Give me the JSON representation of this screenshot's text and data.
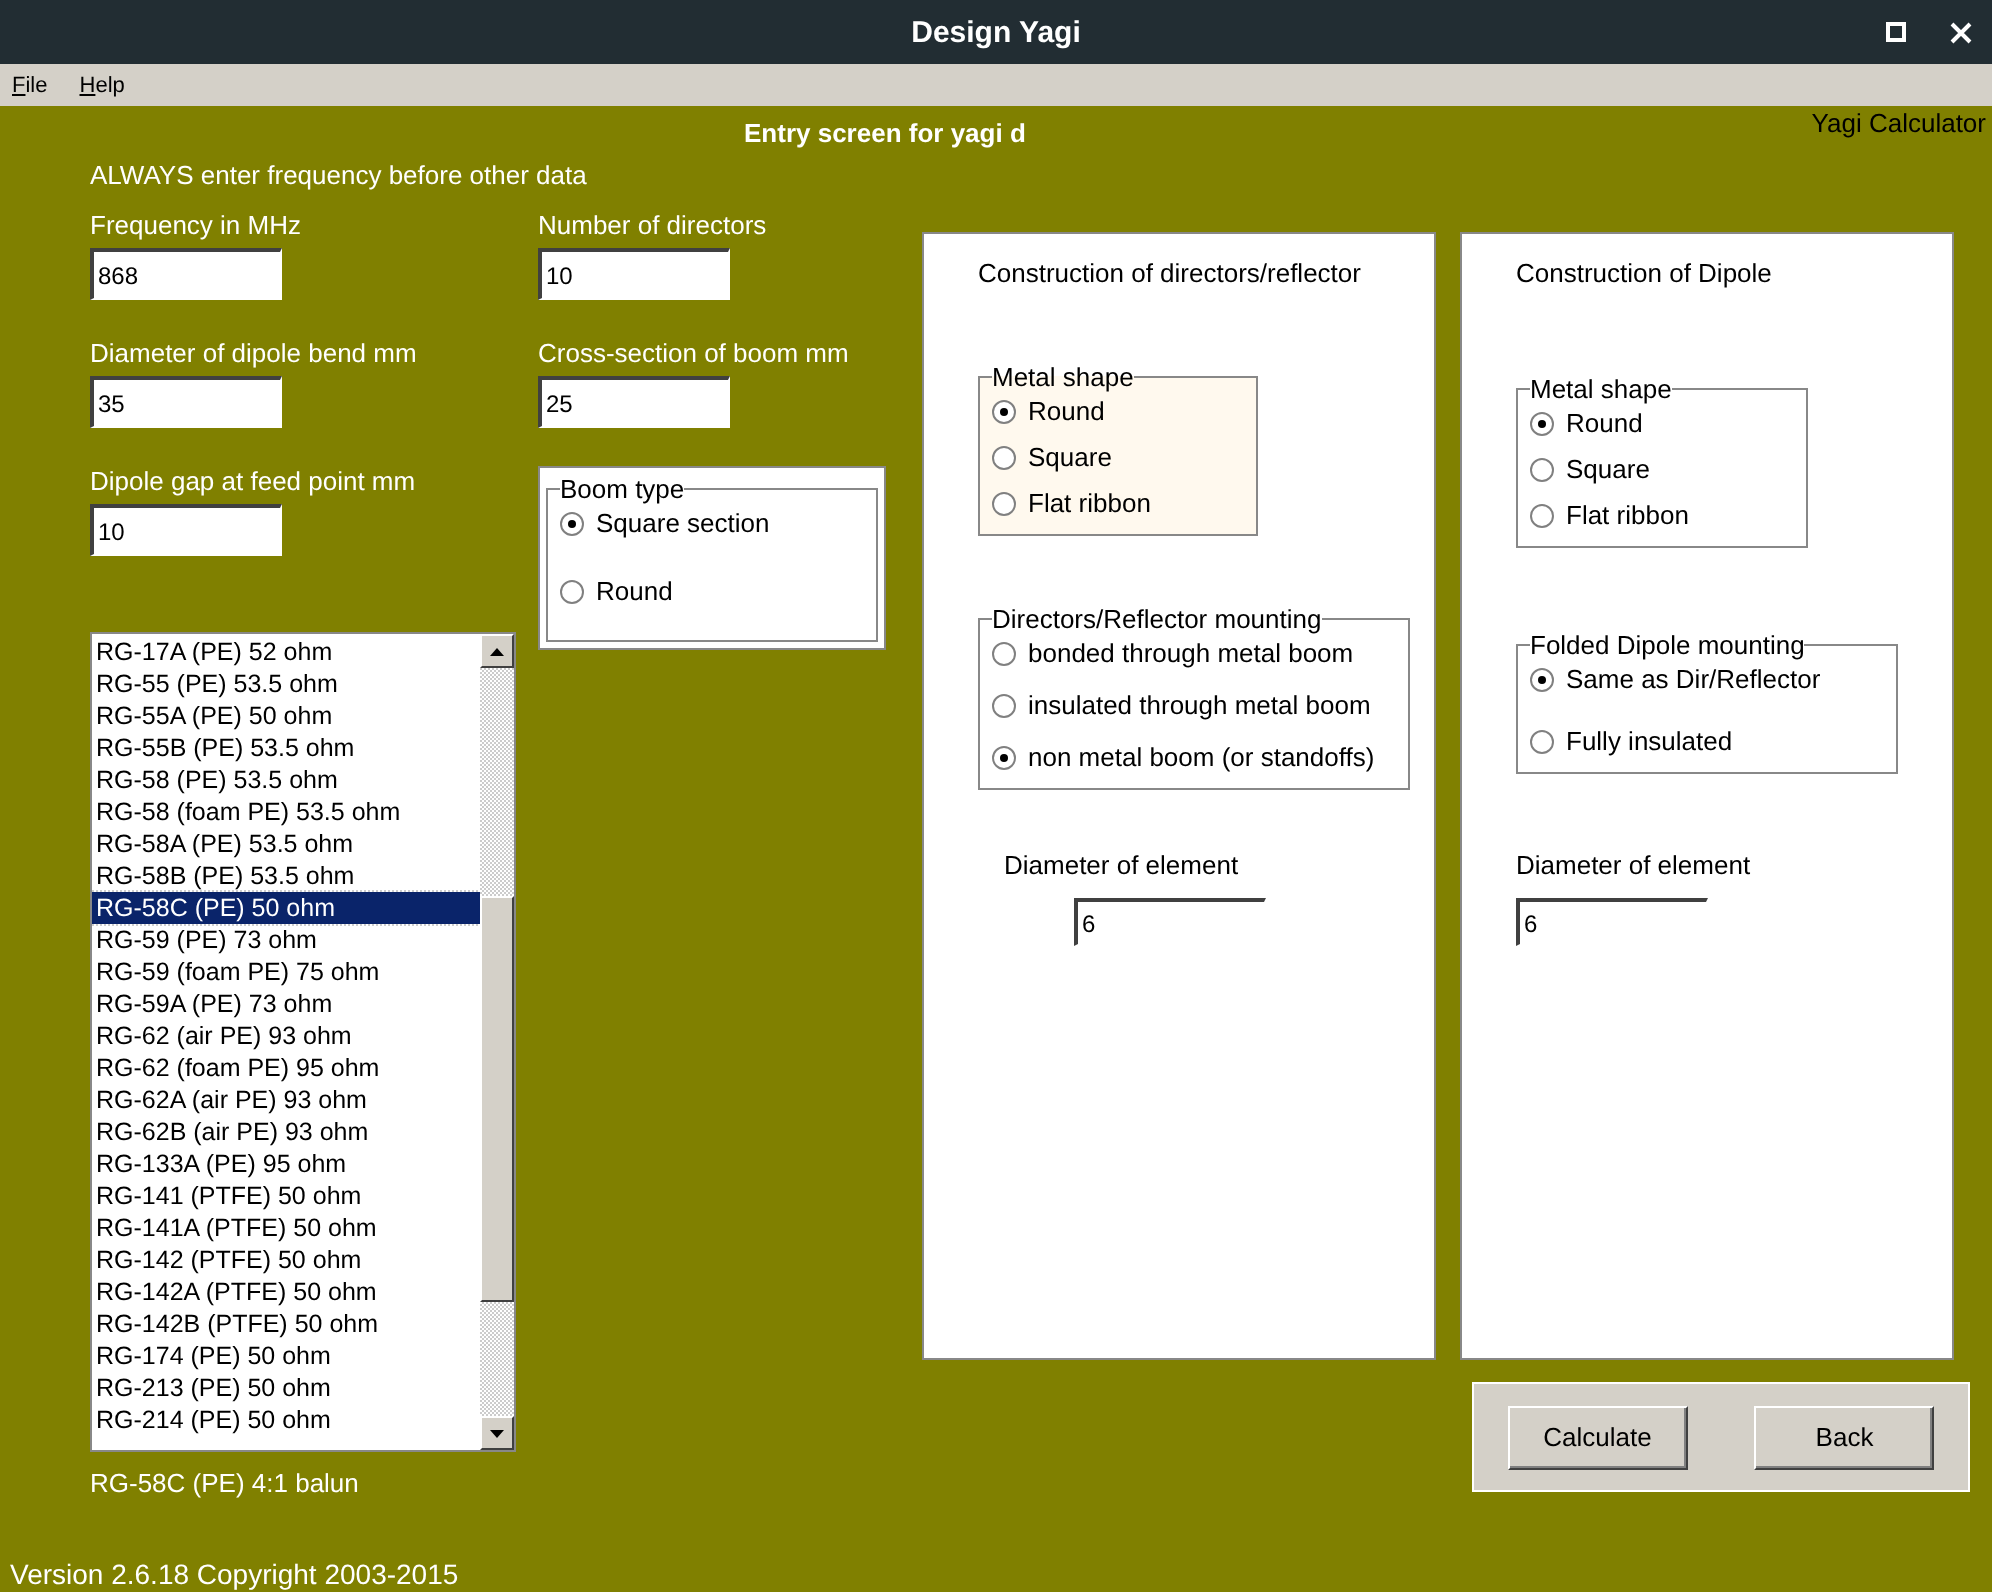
{
  "window": {
    "title": "Design Yagi"
  },
  "menu": [
    "File",
    "Help"
  ],
  "header": {
    "title": "Entry screen for yagi d",
    "app_name": "Yagi Calculator"
  },
  "note": "ALWAYS enter frequency before other data",
  "fields_left": [
    {
      "label": "Frequency in MHz",
      "value": "868"
    },
    {
      "label": "Diameter of dipole bend mm",
      "value": "35"
    },
    {
      "label": "Dipole gap at feed point mm",
      "value": "10"
    }
  ],
  "fields_right": [
    {
      "label": "Number of directors",
      "value": "10"
    },
    {
      "label": "Cross-section of boom mm",
      "value": "25"
    }
  ],
  "boom_type": {
    "legend": "Boom type",
    "options": [
      {
        "label": "Square section",
        "selected": true
      },
      {
        "label": "Round",
        "selected": false
      }
    ]
  },
  "cable_list": [
    {
      "label": "RG-17A (PE) 52 ohm",
      "selected": false
    },
    {
      "label": "RG-55 (PE) 53.5 ohm",
      "selected": false
    },
    {
      "label": "RG-55A (PE) 50 ohm",
      "selected": false
    },
    {
      "label": "RG-55B (PE) 53.5 ohm",
      "selected": false
    },
    {
      "label": "RG-58 (PE) 53.5 ohm",
      "selected": false
    },
    {
      "label": "RG-58 (foam PE) 53.5 ohm",
      "selected": false
    },
    {
      "label": "RG-58A (PE) 53.5 ohm",
      "selected": false
    },
    {
      "label": "RG-58B (PE) 53.5 ohm",
      "selected": false
    },
    {
      "label": "RG-58C (PE) 50 ohm",
      "selected": true
    },
    {
      "label": "RG-59 (PE) 73 ohm",
      "selected": false
    },
    {
      "label": "RG-59 (foam PE) 75 ohm",
      "selected": false
    },
    {
      "label": "RG-59A (PE) 73 ohm",
      "selected": false
    },
    {
      "label": "RG-62 (air PE) 93 ohm",
      "selected": false
    },
    {
      "label": "RG-62 (foam PE) 95 ohm",
      "selected": false
    },
    {
      "label": "RG-62A (air PE) 93 ohm",
      "selected": false
    },
    {
      "label": "RG-62B (air PE) 93 ohm",
      "selected": false
    },
    {
      "label": "RG-133A (PE) 95 ohm",
      "selected": false
    },
    {
      "label": "RG-141 (PTFE) 50 ohm",
      "selected": false
    },
    {
      "label": "RG-141A (PTFE) 50 ohm",
      "selected": false
    },
    {
      "label": "RG-142 (PTFE) 50 ohm",
      "selected": false
    },
    {
      "label": "RG-142A (PTFE) 50 ohm",
      "selected": false
    },
    {
      "label": "RG-142B (PTFE) 50 ohm",
      "selected": false
    },
    {
      "label": "RG-174 (PE) 50 ohm",
      "selected": false
    },
    {
      "label": "RG-213 (PE) 50 ohm",
      "selected": false
    },
    {
      "label": "RG-214 (PE) 50 ohm",
      "selected": false
    }
  ],
  "cable_summary": "RG-58C (PE)  4:1 balun",
  "panels": [
    {
      "title": "Construction of directors/reflector",
      "groups": [
        {
          "legend": "Metal shape",
          "highlighted": true,
          "options": [
            {
              "label": "Round",
              "selected": true
            },
            {
              "label": "Square",
              "selected": false
            },
            {
              "label": "Flat ribbon",
              "selected": false
            }
          ]
        },
        {
          "legend": "Directors/Reflector mounting",
          "highlighted": false,
          "options": [
            {
              "label": "bonded through metal boom",
              "selected": false
            },
            {
              "label": "insulated through metal boom",
              "selected": false
            },
            {
              "label": "non metal boom (or standoffs)",
              "selected": true
            }
          ]
        }
      ],
      "diameter_label": "Diameter of element",
      "diameter_value": "6"
    },
    {
      "title": "Construction of Dipole",
      "groups": [
        {
          "legend": "Metal shape",
          "highlighted": false,
          "options": [
            {
              "label": "Round",
              "selected": true
            },
            {
              "label": "Square",
              "selected": false
            },
            {
              "label": "Flat ribbon",
              "selected": false
            }
          ]
        },
        {
          "legend": "Folded Dipole mounting",
          "highlighted": false,
          "options": [
            {
              "label": "Same as Dir/Reflector",
              "selected": true
            },
            {
              "label": "Fully insulated",
              "selected": false
            }
          ]
        }
      ],
      "diameter_label": "Diameter of element",
      "diameter_value": "6"
    }
  ],
  "buttons": [
    "Calculate",
    "Back"
  ],
  "status": "Version 2.6.18  Copyright 2003-2015"
}
